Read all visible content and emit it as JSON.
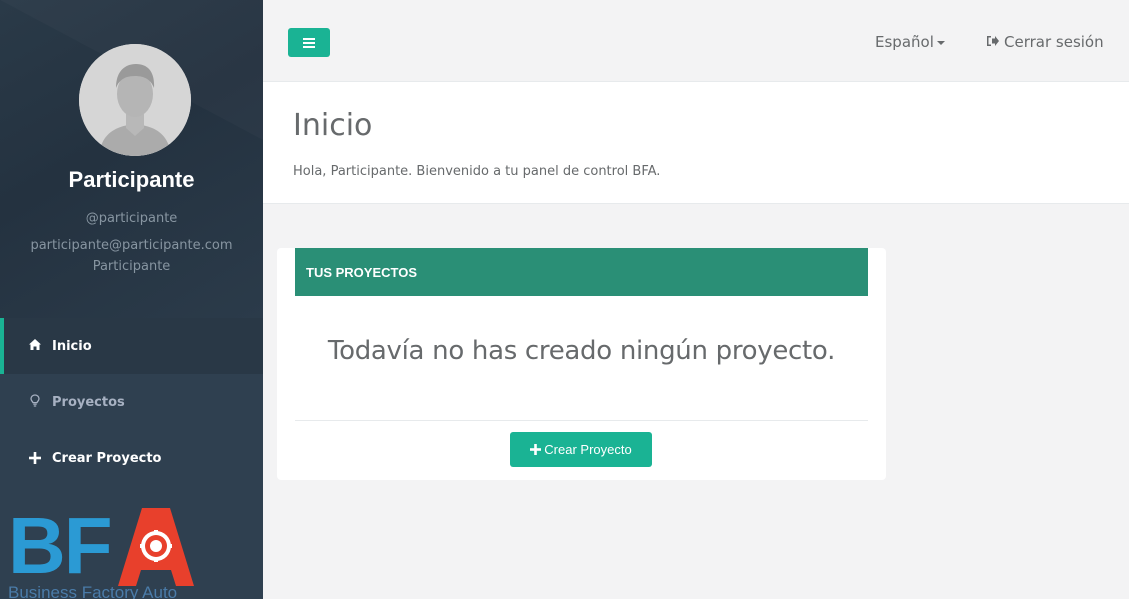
{
  "sidebar": {
    "profile": {
      "name": "Participante",
      "username": "@participante",
      "email": "participante@participante.com",
      "role": "Participante"
    },
    "nav": [
      {
        "label": "Inicio",
        "icon": "home-icon",
        "active": true
      },
      {
        "label": "Proyectos",
        "icon": "lightbulb-icon",
        "active": false
      },
      {
        "label": "Crear Proyecto",
        "icon": "plus-icon",
        "active": false
      }
    ],
    "logo": {
      "letters": "BF",
      "tagline": "Business Factory Auto"
    }
  },
  "topbar": {
    "menu_icon": "hamburger-icon",
    "language": "Español",
    "logout_label": "Cerrar sesión",
    "logout_icon": "sign-out-icon"
  },
  "heading": {
    "title": "Inicio",
    "welcome": "Hola, Participante. Bienvenido a tu panel de control BFA."
  },
  "projects_box": {
    "title": "TUS PROYECTOS",
    "empty_message": "Todavía no has creado ningún proyecto.",
    "create_button": "Crear Proyecto"
  },
  "colors": {
    "sidebar_bg": "#2f4050",
    "accent": "#1ab394",
    "box_header": "#2a8f76",
    "logo_blue": "#2b9ad4",
    "logo_red": "#e8402c"
  }
}
